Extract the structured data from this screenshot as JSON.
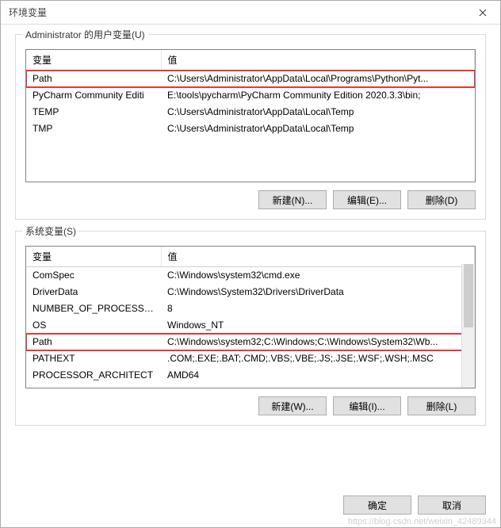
{
  "titlebar": {
    "title": "环境变量"
  },
  "user_vars": {
    "group_label": "Administrator 的用户变量(U)",
    "columns": {
      "name": "变量",
      "value": "值"
    },
    "rows": [
      {
        "name": "Path",
        "value": "C:\\Users\\Administrator\\AppData\\Local\\Programs\\Python\\Pyt...",
        "highlight": true
      },
      {
        "name": "PyCharm Community Editi",
        "value": "E:\\tools\\pycharm\\PyCharm Community Edition 2020.3.3\\bin;",
        "highlight": false
      },
      {
        "name": "TEMP",
        "value": "C:\\Users\\Administrator\\AppData\\Local\\Temp",
        "highlight": false
      },
      {
        "name": "TMP",
        "value": "C:\\Users\\Administrator\\AppData\\Local\\Temp",
        "highlight": false
      }
    ],
    "buttons": {
      "new": "新建(N)...",
      "edit": "编辑(E)...",
      "delete": "删除(D)"
    }
  },
  "system_vars": {
    "group_label": "系统变量(S)",
    "columns": {
      "name": "变量",
      "value": "值"
    },
    "rows": [
      {
        "name": "ComSpec",
        "value": "C:\\Windows\\system32\\cmd.exe",
        "highlight": false
      },
      {
        "name": "DriverData",
        "value": "C:\\Windows\\System32\\Drivers\\DriverData",
        "highlight": false
      },
      {
        "name": "NUMBER_OF_PROCESSORS",
        "value": "8",
        "highlight": false
      },
      {
        "name": "OS",
        "value": "Windows_NT",
        "highlight": false
      },
      {
        "name": "Path",
        "value": "C:\\Windows\\system32;C:\\Windows;C:\\Windows\\System32\\Wb...",
        "highlight": true
      },
      {
        "name": "PATHEXT",
        "value": ".COM;.EXE;.BAT;.CMD;.VBS;.VBE;.JS;.JSE;.WSF;.WSH;.MSC",
        "highlight": false
      },
      {
        "name": "PROCESSOR_ARCHITECT",
        "value": "AMD64",
        "highlight": false
      }
    ],
    "buttons": {
      "new": "新建(W)...",
      "edit": "编辑(I)...",
      "delete": "删除(L)"
    }
  },
  "footer": {
    "ok": "确定",
    "cancel": "取消"
  },
  "watermark": "https://blog.csdn.net/weixin_42489344"
}
